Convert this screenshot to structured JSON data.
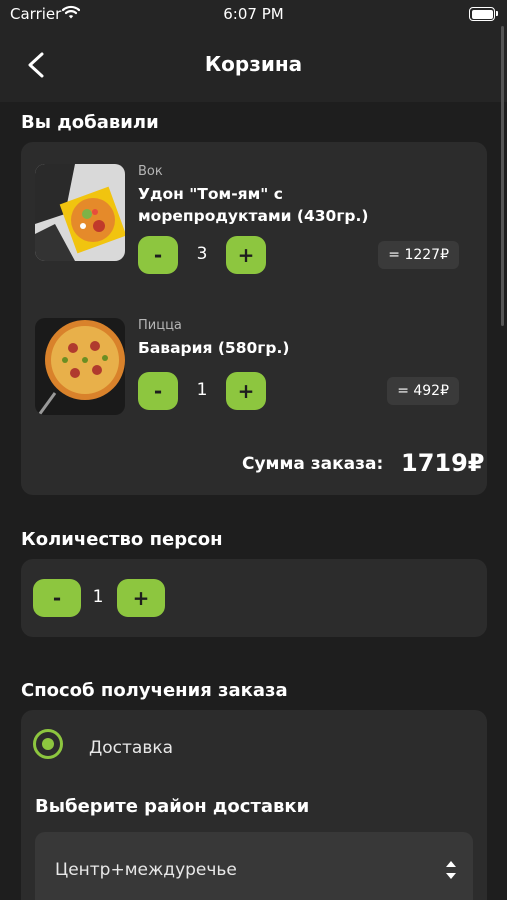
{
  "status_bar": {
    "carrier": "Carrier",
    "time": "6:07 PM"
  },
  "header": {
    "title": "Корзина"
  },
  "cart": {
    "section_title": "Вы добавили",
    "items": [
      {
        "category": "Вок",
        "name": "Удон \"Том-ям\" с морепродуктами (430гр.)",
        "quantity": "3",
        "price": "= 1227₽",
        "image": "wok-noodles-image"
      },
      {
        "category": "Пицца",
        "name": "Бавария (580гр.)",
        "quantity": "1",
        "price": "= 492₽",
        "image": "pizza-image"
      }
    ],
    "minus_label": "-",
    "plus_label": "+",
    "total_label": "Сумма заказа:",
    "total_value": "1719₽"
  },
  "persons": {
    "section_title": "Количество персон",
    "minus_label": "-",
    "plus_label": "+",
    "value": "1"
  },
  "delivery": {
    "section_title": "Способ получения заказа",
    "option_label": "Доставка",
    "option_selected": true,
    "district_title": "Выберите район доставки",
    "district_value": "Центр+междуречье"
  },
  "colors": {
    "accent": "#8dc63f",
    "background": "#1e1e1e",
    "card": "#2c2c2c"
  }
}
